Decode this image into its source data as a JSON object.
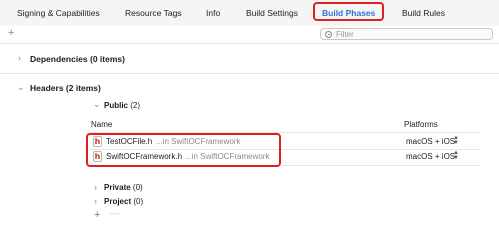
{
  "tabs": [
    {
      "label": "Signing & Capabilities"
    },
    {
      "label": "Resource Tags"
    },
    {
      "label": "Info"
    },
    {
      "label": "Build Settings"
    },
    {
      "label": "Build Phases",
      "active": true
    },
    {
      "label": "Build Rules"
    }
  ],
  "toolbar": {
    "add_symbol": "+",
    "filter_placeholder": "Filter"
  },
  "phases": {
    "dependencies": {
      "title": "Dependencies (0 items)"
    },
    "headers": {
      "title": "Headers (2 items)",
      "public": {
        "label": "Public",
        "count": "(2)"
      },
      "columns": {
        "name": "Name",
        "platforms": "Platforms"
      },
      "files": [
        {
          "name": "TestOCFile.h",
          "path": "...in SwiftOCFramework",
          "platforms": "macOS + iOS"
        },
        {
          "name": "SwiftOCFramework.h",
          "path": "...in SwiftOCFramework",
          "platforms": "macOS + iOS"
        }
      ],
      "private": {
        "label": "Private",
        "count": "(0)"
      },
      "project": {
        "label": "Project",
        "count": "(0)"
      },
      "add_symbol": "+",
      "remove_symbol": "—"
    }
  },
  "icons": {
    "collapsed": "chevron-right-icon",
    "expanded": "chevron-down-icon",
    "header_file": "header-file-icon",
    "stepper": "stepper-icon",
    "filter": "filter-icon"
  },
  "colors": {
    "accent": "#2f6fdc",
    "highlight": "#e02020",
    "header_file_letter": "#c0392b"
  }
}
